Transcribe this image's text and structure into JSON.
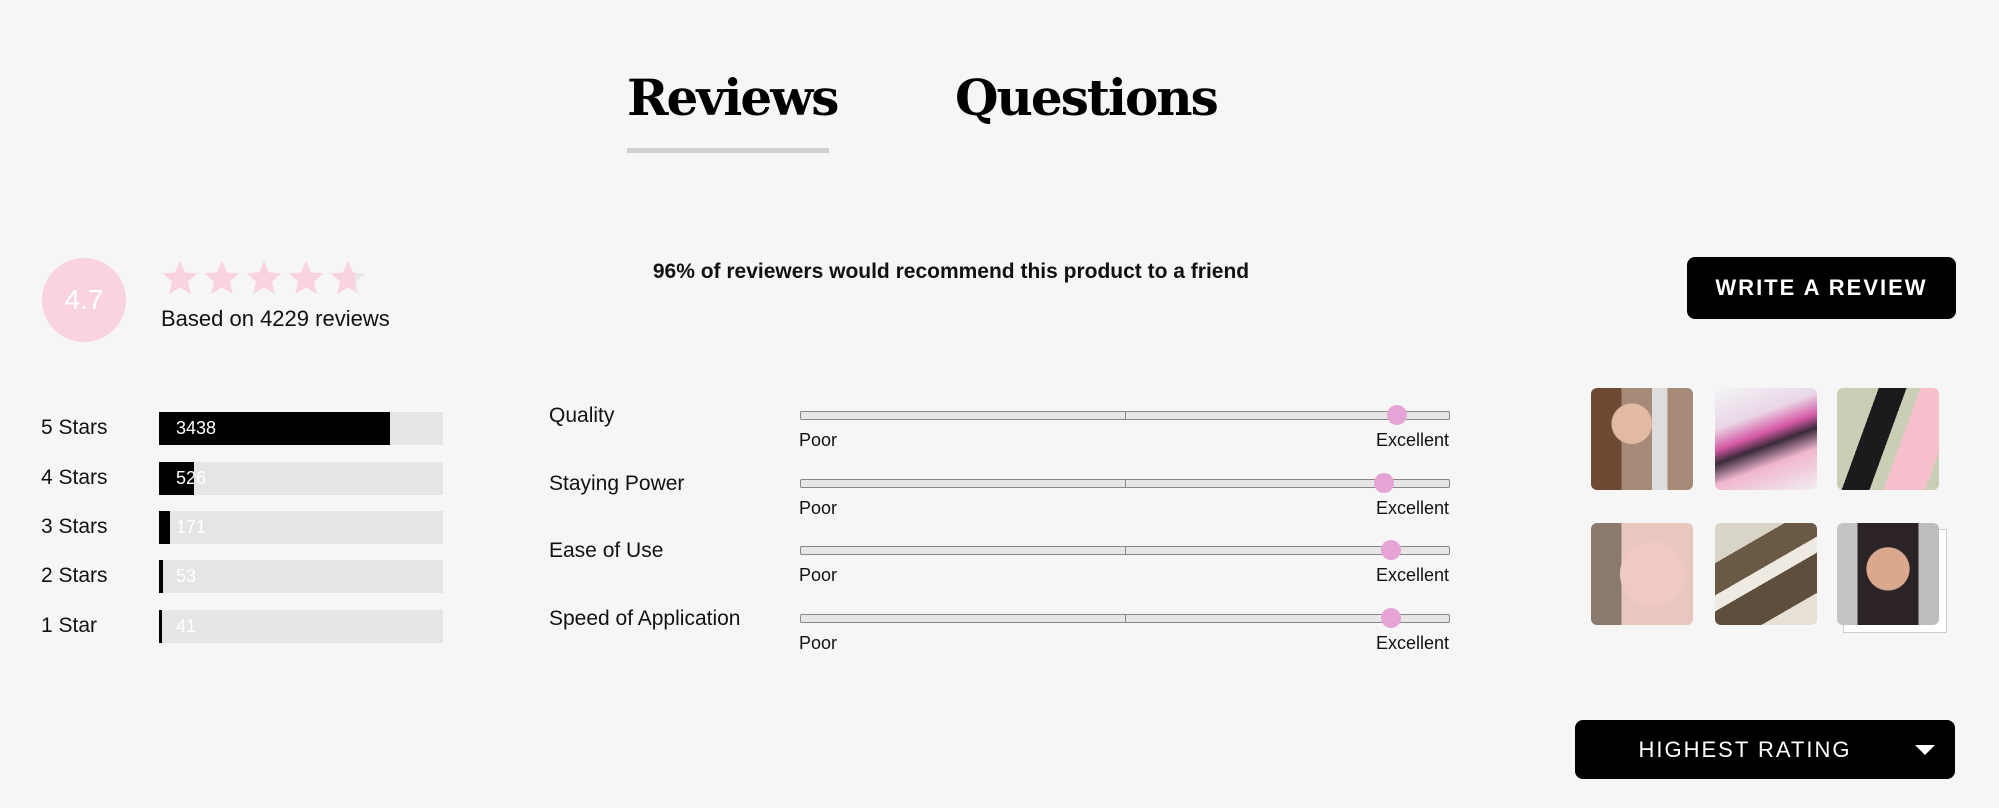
{
  "tabs": [
    {
      "label": "Reviews",
      "active": true
    },
    {
      "label": "Questions",
      "active": false
    }
  ],
  "summary": {
    "average_rating": "4.7",
    "rating_value": 4.7,
    "max_rating": 5,
    "based_on": "Based on 4229 reviews",
    "total_reviews": 4229,
    "recommend_text": "96% of reviewers would recommend this product to a friend",
    "star_color": "#f9d3e0"
  },
  "write_review_label": "WRITE A REVIEW",
  "histogram": [
    {
      "label": "5 Stars",
      "count": "3438"
    },
    {
      "label": "4 Stars",
      "count": "526"
    },
    {
      "label": "3 Stars",
      "count": "171"
    },
    {
      "label": "2 Stars",
      "count": "53"
    },
    {
      "label": "1 Star",
      "count": "41"
    }
  ],
  "characteristics": [
    {
      "label": "Quality",
      "min_label": "Poor",
      "max_label": "Excellent",
      "level_percent": 92
    },
    {
      "label": "Staying Power",
      "min_label": "Poor",
      "max_label": "Excellent",
      "level_percent": 90
    },
    {
      "label": "Ease of Use",
      "min_label": "Poor",
      "max_label": "Excellent",
      "level_percent": 91
    },
    {
      "label": "Speed of Application",
      "min_label": "Poor",
      "max_label": "Excellent",
      "level_percent": 91
    }
  ],
  "thumb_color": "#e6a3d5",
  "photos": [
    {
      "name": "review-photo-selfie"
    },
    {
      "name": "review-photo-products-pink"
    },
    {
      "name": "review-photo-pens-box"
    },
    {
      "name": "review-photo-eye-makeup"
    },
    {
      "name": "review-photo-brown-pens"
    },
    {
      "name": "review-photo-smiling-woman"
    }
  ],
  "sort": {
    "selected": "HIGHEST RATING"
  }
}
